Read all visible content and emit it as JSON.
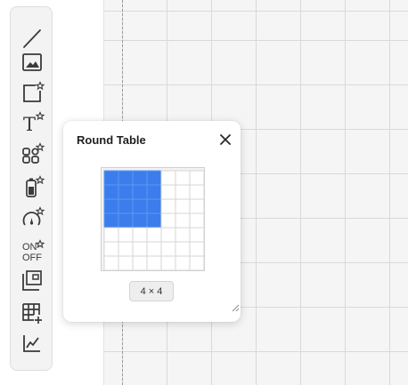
{
  "colors": {
    "selected_cell": "#3b7ded",
    "empty_cell": "#ffffff",
    "cell_border": "#d6d6d6",
    "icon": "#3a3a3a"
  },
  "toolbar": {
    "tools": [
      {
        "name": "line-tool",
        "icon": "diagonal-line-icon",
        "premium": false
      },
      {
        "name": "image-tool",
        "icon": "image-icon",
        "premium": false
      },
      {
        "name": "shape-tool",
        "icon": "rectangle-icon",
        "premium": true
      },
      {
        "name": "text-tool",
        "icon": "text-t-icon",
        "premium": true
      },
      {
        "name": "component-tool",
        "icon": "widgets-icon",
        "premium": true
      },
      {
        "name": "battery-tool",
        "icon": "battery-icon",
        "premium": true
      },
      {
        "name": "gauge-tool",
        "icon": "gauge-icon",
        "premium": true
      },
      {
        "name": "toggle-tool",
        "icon": "on-off-icon",
        "premium": true
      },
      {
        "name": "frame-tool",
        "icon": "frame-icon",
        "premium": false
      },
      {
        "name": "table-tool",
        "icon": "table-add-icon",
        "premium": false
      },
      {
        "name": "chart-tool",
        "icon": "line-chart-icon",
        "premium": false
      }
    ],
    "toggle_on": "ON",
    "toggle_off": "OFF",
    "text_glyph": "T"
  },
  "popup": {
    "title": "Round Table",
    "close_icon": "close-icon",
    "grid": {
      "columns": 7,
      "rows": 7,
      "selected_columns": 4,
      "selected_rows": 4
    },
    "size_label": "4 × 4"
  }
}
